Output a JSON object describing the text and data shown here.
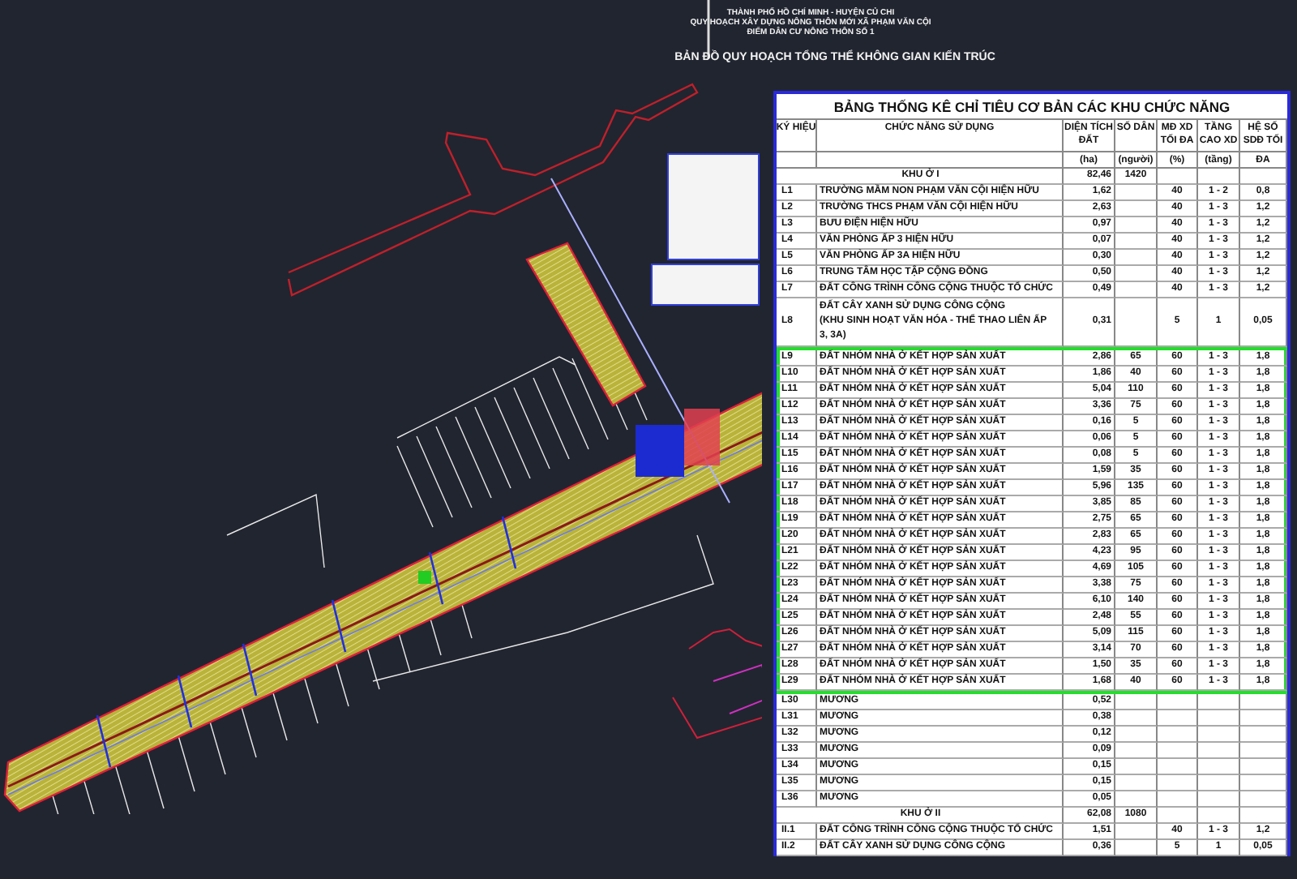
{
  "header": {
    "lines": [
      "THÀNH PHỐ HỒ CHÍ MINH - HUYỆN CỦ CHI",
      "QUY HOẠCH XÂY DỰNG NÔNG THÔN MỚI XÃ PHẠM VĂN CỘI",
      "ĐIỂM DÂN CƯ NÔNG THÔN SỐ 1"
    ],
    "title": "BẢN ĐỒ QUY HOẠCH TỔNG THỂ KHÔNG GIAN KIẾN TRÚC"
  },
  "table": {
    "title": "BẢNG THỐNG KÊ CHỈ TIÊU CƠ BẢN CÁC KHU CHỨC NĂNG",
    "columns": [
      {
        "label": "KÝ HIỆU"
      },
      {
        "label": "CHỨC NĂNG SỬ DỤNG"
      },
      {
        "label": "DIỆN TÍCH ĐẤT",
        "unit": "(ha)"
      },
      {
        "label": "SỐ DÂN",
        "unit": "(người)"
      },
      {
        "label": "MĐ XD TỐI ĐA",
        "unit": "(%)"
      },
      {
        "label": "TẦNG CAO XD",
        "unit": "(tầng)"
      },
      {
        "label": "HỆ SỐ SDĐ TỐI",
        "unit": "ĐA"
      }
    ],
    "sections": [
      {
        "highlighted": false,
        "rows": [
          {
            "kind": "group",
            "name": [
              "KHU Ở I"
            ],
            "area": "82,46",
            "population": "1420"
          },
          {
            "kind": "item",
            "code": "L1",
            "name": [
              "TRƯỜNG MẦM NON PHẠM VĂN CỘI HIỆN HỮU"
            ],
            "area": "1,62",
            "coverage": "40",
            "floors": "1 - 2",
            "far": "0,8"
          },
          {
            "kind": "item",
            "code": "L2",
            "name": [
              "TRƯỜNG THCS PHẠM VĂN CỘI HIỆN HỮU"
            ],
            "area": "2,63",
            "coverage": "40",
            "floors": "1 - 3",
            "far": "1,2"
          },
          {
            "kind": "item",
            "code": "L3",
            "name": [
              "BƯU ĐIỆN HIỆN HỮU"
            ],
            "area": "0,97",
            "coverage": "40",
            "floors": "1 - 3",
            "far": "1,2"
          },
          {
            "kind": "item",
            "code": "L4",
            "name": [
              "VĂN PHÒNG ẤP 3 HIỆN HỮU"
            ],
            "area": "0,07",
            "coverage": "40",
            "floors": "1 - 3",
            "far": "1,2"
          },
          {
            "kind": "item",
            "code": "L5",
            "name": [
              "VĂN PHÒNG ẤP 3A HIỆN HỮU"
            ],
            "area": "0,30",
            "coverage": "40",
            "floors": "1 - 3",
            "far": "1,2"
          },
          {
            "kind": "item",
            "code": "L6",
            "name": [
              "TRUNG TÂM HỌC TẬP CỘNG ĐỒNG"
            ],
            "area": "0,50",
            "coverage": "40",
            "floors": "1 - 3",
            "far": "1,2"
          },
          {
            "kind": "item",
            "code": "L7",
            "name": [
              "ĐẤT CÔNG TRÌNH CÔNG CỘNG THUỘC TỔ CHỨC"
            ],
            "area": "0,49",
            "coverage": "40",
            "floors": "1 - 3",
            "far": "1,2"
          },
          {
            "kind": "item",
            "code": "L8",
            "name": [
              "ĐẤT CÂY XANH SỬ DỤNG CÔNG CỘNG",
              "(KHU SINH HOẠT VĂN HÓA - THỂ THAO LIÊN ẤP",
              "3, 3A)"
            ],
            "area": "0,31",
            "coverage": "5",
            "floors": "1",
            "far": "0,05"
          }
        ]
      },
      {
        "highlighted": true,
        "rows": [
          {
            "kind": "item",
            "code": "L9",
            "name": [
              "ĐẤT NHÓM NHÀ Ở KẾT HỢP SẢN XUẤT"
            ],
            "area": "2,86",
            "population": "65",
            "coverage": "60",
            "floors": "1 - 3",
            "far": "1,8"
          },
          {
            "kind": "item",
            "code": "L10",
            "name": [
              "ĐẤT NHÓM NHÀ Ở KẾT HỢP SẢN XUẤT"
            ],
            "area": "1,86",
            "population": "40",
            "coverage": "60",
            "floors": "1 - 3",
            "far": "1,8"
          },
          {
            "kind": "item",
            "code": "L11",
            "name": [
              "ĐẤT NHÓM NHÀ Ở KẾT HỢP SẢN XUẤT"
            ],
            "area": "5,04",
            "population": "110",
            "coverage": "60",
            "floors": "1 - 3",
            "far": "1,8"
          },
          {
            "kind": "item",
            "code": "L12",
            "name": [
              "ĐẤT NHÓM NHÀ Ở KẾT HỢP SẢN XUẤT"
            ],
            "area": "3,36",
            "population": "75",
            "coverage": "60",
            "floors": "1 - 3",
            "far": "1,8"
          },
          {
            "kind": "item",
            "code": "L13",
            "name": [
              "ĐẤT NHÓM NHÀ Ở KẾT HỢP SẢN XUẤT"
            ],
            "area": "0,16",
            "population": "5",
            "coverage": "60",
            "floors": "1 - 3",
            "far": "1,8"
          },
          {
            "kind": "item",
            "code": "L14",
            "name": [
              "ĐẤT NHÓM NHÀ Ở KẾT HỢP SẢN XUẤT"
            ],
            "area": "0,06",
            "population": "5",
            "coverage": "60",
            "floors": "1 - 3",
            "far": "1,8"
          },
          {
            "kind": "item",
            "code": "L15",
            "name": [
              "ĐẤT NHÓM NHÀ Ở KẾT HỢP SẢN XUẤT"
            ],
            "area": "0,08",
            "population": "5",
            "coverage": "60",
            "floors": "1 - 3",
            "far": "1,8"
          },
          {
            "kind": "item",
            "code": "L16",
            "name": [
              "ĐẤT NHÓM NHÀ Ở KẾT HỢP SẢN XUẤT"
            ],
            "area": "1,59",
            "population": "35",
            "coverage": "60",
            "floors": "1 - 3",
            "far": "1,8"
          },
          {
            "kind": "item",
            "code": "L17",
            "name": [
              "ĐẤT NHÓM NHÀ Ở KẾT HỢP SẢN XUẤT"
            ],
            "area": "5,96",
            "population": "135",
            "coverage": "60",
            "floors": "1 - 3",
            "far": "1,8"
          },
          {
            "kind": "item",
            "code": "L18",
            "name": [
              "ĐẤT NHÓM NHÀ Ở KẾT HỢP SẢN XUẤT"
            ],
            "area": "3,85",
            "population": "85",
            "coverage": "60",
            "floors": "1 - 3",
            "far": "1,8"
          },
          {
            "kind": "item",
            "code": "L19",
            "name": [
              "ĐẤT NHÓM NHÀ Ở KẾT HỢP SẢN XUẤT"
            ],
            "area": "2,75",
            "population": "65",
            "coverage": "60",
            "floors": "1 - 3",
            "far": "1,8"
          },
          {
            "kind": "item",
            "code": "L20",
            "name": [
              "ĐẤT NHÓM NHÀ Ở KẾT HỢP SẢN XUẤT"
            ],
            "area": "2,83",
            "population": "65",
            "coverage": "60",
            "floors": "1 - 3",
            "far": "1,8"
          },
          {
            "kind": "item",
            "code": "L21",
            "name": [
              "ĐẤT NHÓM NHÀ Ở KẾT HỢP SẢN XUẤT"
            ],
            "area": "4,23",
            "population": "95",
            "coverage": "60",
            "floors": "1 - 3",
            "far": "1,8"
          },
          {
            "kind": "item",
            "code": "L22",
            "name": [
              "ĐẤT NHÓM NHÀ Ở KẾT HỢP SẢN XUẤT"
            ],
            "area": "4,69",
            "population": "105",
            "coverage": "60",
            "floors": "1 - 3",
            "far": "1,8"
          },
          {
            "kind": "item",
            "code": "L23",
            "name": [
              "ĐẤT NHÓM NHÀ Ở KẾT HỢP SẢN XUẤT"
            ],
            "area": "3,38",
            "population": "75",
            "coverage": "60",
            "floors": "1 - 3",
            "far": "1,8"
          },
          {
            "kind": "item",
            "code": "L24",
            "name": [
              "ĐẤT NHÓM NHÀ Ở KẾT HỢP SẢN XUẤT"
            ],
            "area": "6,10",
            "population": "140",
            "coverage": "60",
            "floors": "1 - 3",
            "far": "1,8"
          },
          {
            "kind": "item",
            "code": "L25",
            "name": [
              "ĐẤT NHÓM NHÀ Ở KẾT HỢP SẢN XUẤT"
            ],
            "area": "2,48",
            "population": "55",
            "coverage": "60",
            "floors": "1 - 3",
            "far": "1,8"
          },
          {
            "kind": "item",
            "code": "L26",
            "name": [
              "ĐẤT NHÓM NHÀ Ở KẾT HỢP SẢN XUẤT"
            ],
            "area": "5,09",
            "population": "115",
            "coverage": "60",
            "floors": "1 - 3",
            "far": "1,8"
          },
          {
            "kind": "item",
            "code": "L27",
            "name": [
              "ĐẤT NHÓM NHÀ Ở KẾT HỢP SẢN XUẤT"
            ],
            "area": "3,14",
            "population": "70",
            "coverage": "60",
            "floors": "1 - 3",
            "far": "1,8"
          },
          {
            "kind": "item",
            "code": "L28",
            "name": [
              "ĐẤT NHÓM NHÀ Ở KẾT HỢP SẢN XUẤT"
            ],
            "area": "1,50",
            "population": "35",
            "coverage": "60",
            "floors": "1 - 3",
            "far": "1,8"
          },
          {
            "kind": "item",
            "code": "L29",
            "name": [
              "ĐẤT NHÓM NHÀ Ở KẾT HỢP SẢN XUẤT"
            ],
            "area": "1,68",
            "population": "40",
            "coverage": "60",
            "floors": "1 - 3",
            "far": "1,8"
          }
        ]
      },
      {
        "highlighted": false,
        "rows": [
          {
            "kind": "item",
            "code": "L30",
            "name": [
              "MƯƠNG"
            ],
            "area": "0,52"
          },
          {
            "kind": "item",
            "code": "L31",
            "name": [
              "MƯƠNG"
            ],
            "area": "0,38"
          },
          {
            "kind": "item",
            "code": "L32",
            "name": [
              "MƯƠNG"
            ],
            "area": "0,12"
          },
          {
            "kind": "item",
            "code": "L33",
            "name": [
              "MƯƠNG"
            ],
            "area": "0,09"
          },
          {
            "kind": "item",
            "code": "L34",
            "name": [
              "MƯƠNG"
            ],
            "area": "0,15"
          },
          {
            "kind": "item",
            "code": "L35",
            "name": [
              "MƯƠNG"
            ],
            "area": "0,15"
          },
          {
            "kind": "item",
            "code": "L36",
            "name": [
              "MƯƠNG"
            ],
            "area": "0,05"
          },
          {
            "kind": "group",
            "name": [
              "KHU Ở II"
            ],
            "area": "62,08",
            "population": "1080"
          },
          {
            "kind": "item",
            "code": "II.1",
            "name": [
              "ĐẤT CÔNG TRÌNH CÔNG CỘNG THUỘC TỔ CHỨC"
            ],
            "area": "1,51",
            "coverage": "40",
            "floors": "1 - 3",
            "far": "1,2"
          },
          {
            "kind": "item",
            "code": "II.2",
            "name": [
              "ĐẤT CÂY XANH SỬ DỤNG CÔNG CỘNG"
            ],
            "area": "0,36",
            "coverage": "5",
            "floors": "1",
            "far": "0,05"
          }
        ]
      }
    ]
  }
}
